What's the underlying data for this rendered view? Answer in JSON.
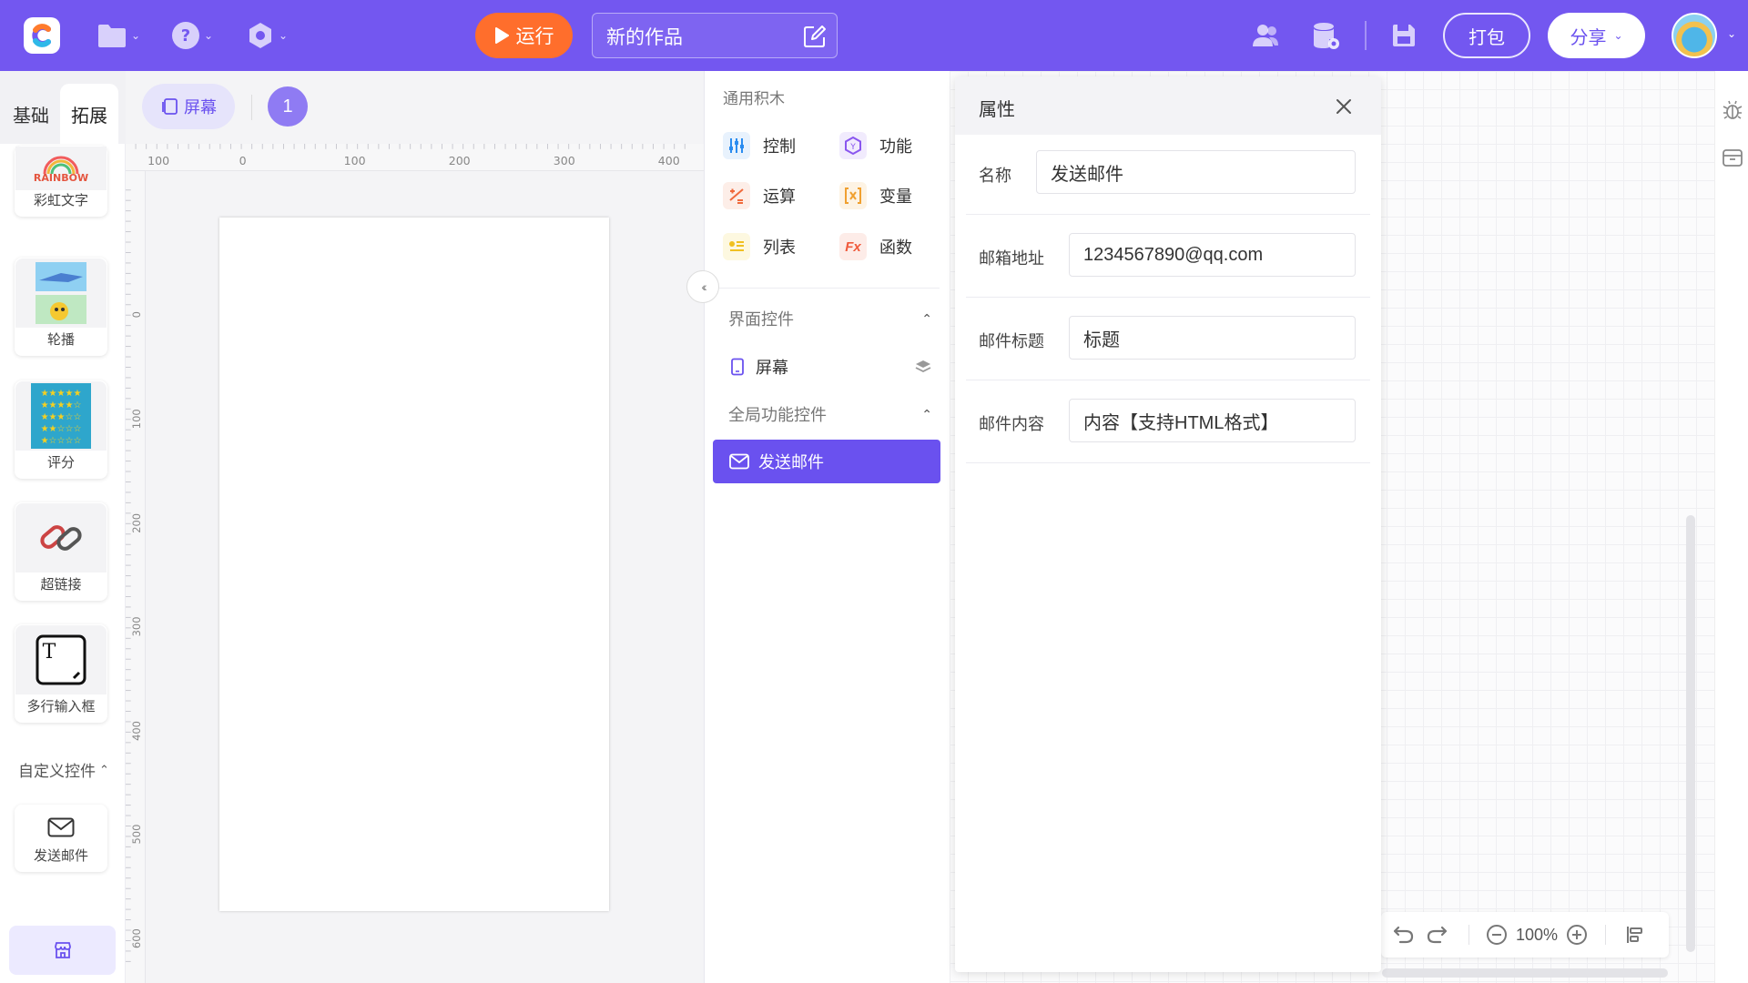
{
  "topbar": {
    "run_label": "运行",
    "project_title": "新的作品",
    "pack_label": "打包",
    "share_label": "分享",
    "icons": [
      "folder-icon",
      "help-icon",
      "settings-icon",
      "users-icon",
      "database-icon",
      "save-icon"
    ]
  },
  "leftbar": {
    "tabs": [
      "基础",
      "拓展"
    ],
    "active_tab": "拓展",
    "components": [
      {
        "label": "彩虹文字",
        "thumb_text": "RAINBOW"
      },
      {
        "label": "轮播"
      },
      {
        "label": "评分"
      },
      {
        "label": "超链接"
      },
      {
        "label": "多行输入框",
        "thumb_text": "T"
      }
    ],
    "custom_section": "自定义控件",
    "custom_components": [
      {
        "label": "发送邮件"
      }
    ]
  },
  "canvas": {
    "screen_chip": "屏幕",
    "screen_number": "1",
    "h_ruler_labels": [
      "100",
      "0",
      "100",
      "200",
      "300",
      "400"
    ],
    "v_ruler_labels": [
      "0",
      "100",
      "200",
      "300",
      "400",
      "500",
      "600"
    ]
  },
  "blocks": {
    "general_title": "通用积木",
    "items": [
      {
        "label": "控制",
        "color": "#2a8cf0"
      },
      {
        "label": "功能",
        "color": "#8a56ef"
      },
      {
        "label": "运算",
        "color": "#f06a3c"
      },
      {
        "label": "变量",
        "color": "#f0a030"
      },
      {
        "label": "列表",
        "color": "#f0c020"
      },
      {
        "label": "函数",
        "color": "#f05a3c",
        "icon_text": "Fx"
      }
    ],
    "ui_group": "界面控件",
    "screen_item": "屏幕",
    "global_group": "全局功能控件",
    "selected_item": "发送邮件"
  },
  "properties": {
    "title": "属性",
    "fields": [
      {
        "label": "名称",
        "value": "发送邮件"
      },
      {
        "label": "邮箱地址",
        "value": "1234567890@qq.com"
      },
      {
        "label": "邮件标题",
        "value": "标题"
      },
      {
        "label": "邮件内容",
        "value": "内容【支持HTML格式】"
      }
    ]
  },
  "workspace": {
    "zoom": "100%"
  },
  "colors": {
    "brand": "#7357f0",
    "accent": "#6a51ef",
    "run": "#ff6e2c"
  }
}
